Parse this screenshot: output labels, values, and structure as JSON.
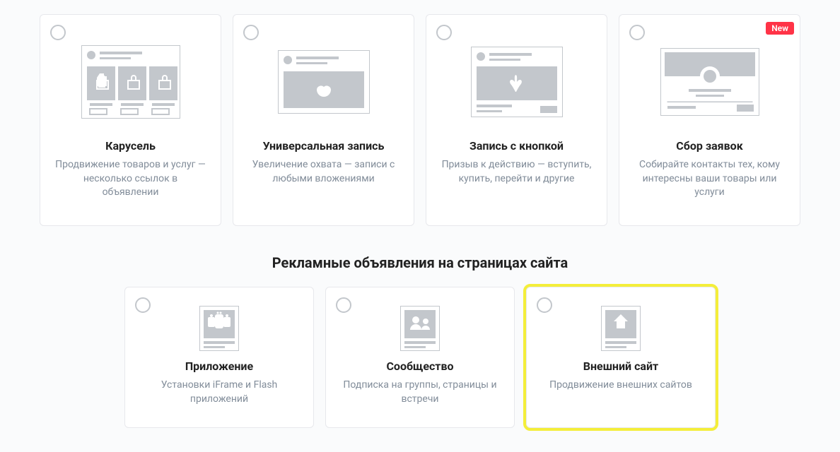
{
  "topCards": [
    {
      "title": "Карусель",
      "desc": "Продвижение товаров и услуг — несколько ссылок в объявлении",
      "badge": null
    },
    {
      "title": "Универсальная запись",
      "desc": "Увеличение охвата — записи с любыми вложениями",
      "badge": null
    },
    {
      "title": "Запись с кнопкой",
      "desc": "Призыв к действию — вступить, купить, перейти и другие",
      "badge": null
    },
    {
      "title": "Сбор заявок",
      "desc": "Собирайте контакты тех, кому интересны ваши товары или услуги",
      "badge": "New"
    }
  ],
  "sectionTitle": "Рекламные объявления на страницах сайта",
  "bottomCards": [
    {
      "title": "Приложение",
      "desc": "Установки iFrame и Flash приложений"
    },
    {
      "title": "Сообщество",
      "desc": "Подписка на группы, страницы и встречи"
    },
    {
      "title": "Внешний сайт",
      "desc": "Продвижение внешних сайтов"
    }
  ]
}
